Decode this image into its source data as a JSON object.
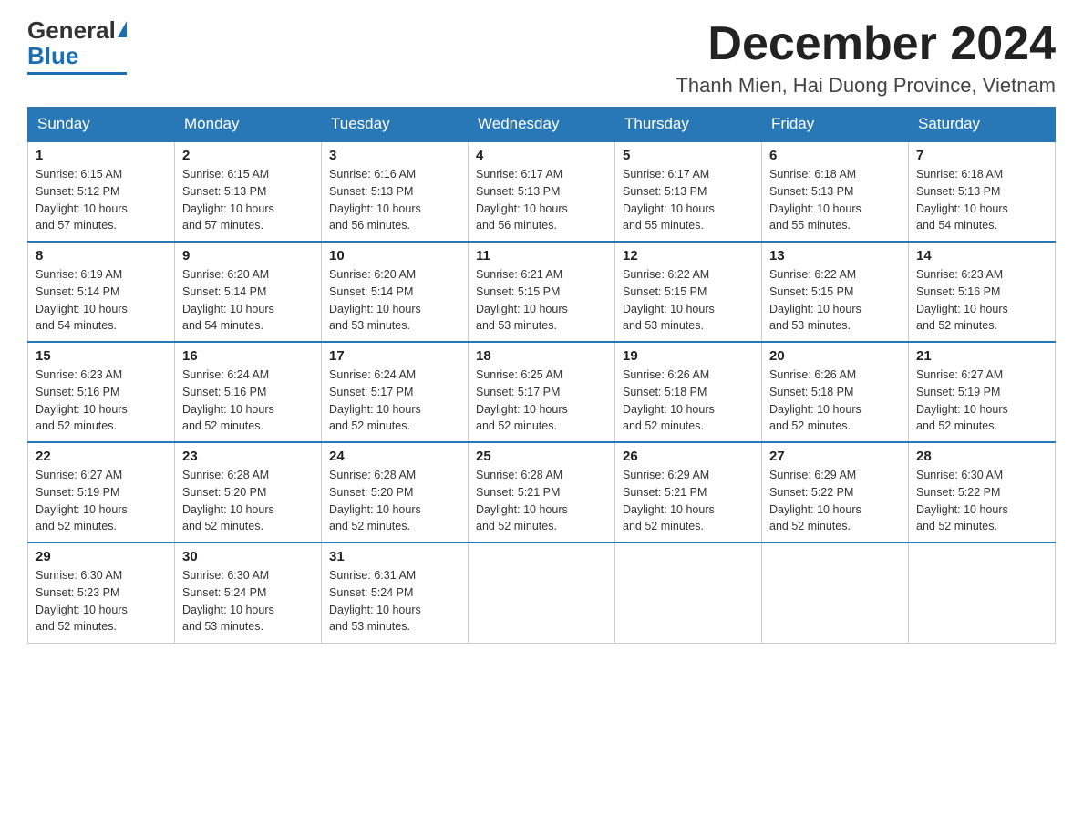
{
  "logo": {
    "general": "General",
    "blue": "Blue"
  },
  "title": "December 2024",
  "location": "Thanh Mien, Hai Duong Province, Vietnam",
  "days_of_week": [
    "Sunday",
    "Monday",
    "Tuesday",
    "Wednesday",
    "Thursday",
    "Friday",
    "Saturday"
  ],
  "weeks": [
    [
      {
        "day": "1",
        "sunrise": "6:15 AM",
        "sunset": "5:12 PM",
        "daylight": "10 hours and 57 minutes."
      },
      {
        "day": "2",
        "sunrise": "6:15 AM",
        "sunset": "5:13 PM",
        "daylight": "10 hours and 57 minutes."
      },
      {
        "day": "3",
        "sunrise": "6:16 AM",
        "sunset": "5:13 PM",
        "daylight": "10 hours and 56 minutes."
      },
      {
        "day": "4",
        "sunrise": "6:17 AM",
        "sunset": "5:13 PM",
        "daylight": "10 hours and 56 minutes."
      },
      {
        "day": "5",
        "sunrise": "6:17 AM",
        "sunset": "5:13 PM",
        "daylight": "10 hours and 55 minutes."
      },
      {
        "day": "6",
        "sunrise": "6:18 AM",
        "sunset": "5:13 PM",
        "daylight": "10 hours and 55 minutes."
      },
      {
        "day": "7",
        "sunrise": "6:18 AM",
        "sunset": "5:13 PM",
        "daylight": "10 hours and 54 minutes."
      }
    ],
    [
      {
        "day": "8",
        "sunrise": "6:19 AM",
        "sunset": "5:14 PM",
        "daylight": "10 hours and 54 minutes."
      },
      {
        "day": "9",
        "sunrise": "6:20 AM",
        "sunset": "5:14 PM",
        "daylight": "10 hours and 54 minutes."
      },
      {
        "day": "10",
        "sunrise": "6:20 AM",
        "sunset": "5:14 PM",
        "daylight": "10 hours and 53 minutes."
      },
      {
        "day": "11",
        "sunrise": "6:21 AM",
        "sunset": "5:15 PM",
        "daylight": "10 hours and 53 minutes."
      },
      {
        "day": "12",
        "sunrise": "6:22 AM",
        "sunset": "5:15 PM",
        "daylight": "10 hours and 53 minutes."
      },
      {
        "day": "13",
        "sunrise": "6:22 AM",
        "sunset": "5:15 PM",
        "daylight": "10 hours and 53 minutes."
      },
      {
        "day": "14",
        "sunrise": "6:23 AM",
        "sunset": "5:16 PM",
        "daylight": "10 hours and 52 minutes."
      }
    ],
    [
      {
        "day": "15",
        "sunrise": "6:23 AM",
        "sunset": "5:16 PM",
        "daylight": "10 hours and 52 minutes."
      },
      {
        "day": "16",
        "sunrise": "6:24 AM",
        "sunset": "5:16 PM",
        "daylight": "10 hours and 52 minutes."
      },
      {
        "day": "17",
        "sunrise": "6:24 AM",
        "sunset": "5:17 PM",
        "daylight": "10 hours and 52 minutes."
      },
      {
        "day": "18",
        "sunrise": "6:25 AM",
        "sunset": "5:17 PM",
        "daylight": "10 hours and 52 minutes."
      },
      {
        "day": "19",
        "sunrise": "6:26 AM",
        "sunset": "5:18 PM",
        "daylight": "10 hours and 52 minutes."
      },
      {
        "day": "20",
        "sunrise": "6:26 AM",
        "sunset": "5:18 PM",
        "daylight": "10 hours and 52 minutes."
      },
      {
        "day": "21",
        "sunrise": "6:27 AM",
        "sunset": "5:19 PM",
        "daylight": "10 hours and 52 minutes."
      }
    ],
    [
      {
        "day": "22",
        "sunrise": "6:27 AM",
        "sunset": "5:19 PM",
        "daylight": "10 hours and 52 minutes."
      },
      {
        "day": "23",
        "sunrise": "6:28 AM",
        "sunset": "5:20 PM",
        "daylight": "10 hours and 52 minutes."
      },
      {
        "day": "24",
        "sunrise": "6:28 AM",
        "sunset": "5:20 PM",
        "daylight": "10 hours and 52 minutes."
      },
      {
        "day": "25",
        "sunrise": "6:28 AM",
        "sunset": "5:21 PM",
        "daylight": "10 hours and 52 minutes."
      },
      {
        "day": "26",
        "sunrise": "6:29 AM",
        "sunset": "5:21 PM",
        "daylight": "10 hours and 52 minutes."
      },
      {
        "day": "27",
        "sunrise": "6:29 AM",
        "sunset": "5:22 PM",
        "daylight": "10 hours and 52 minutes."
      },
      {
        "day": "28",
        "sunrise": "6:30 AM",
        "sunset": "5:22 PM",
        "daylight": "10 hours and 52 minutes."
      }
    ],
    [
      {
        "day": "29",
        "sunrise": "6:30 AM",
        "sunset": "5:23 PM",
        "daylight": "10 hours and 52 minutes."
      },
      {
        "day": "30",
        "sunrise": "6:30 AM",
        "sunset": "5:24 PM",
        "daylight": "10 hours and 53 minutes."
      },
      {
        "day": "31",
        "sunrise": "6:31 AM",
        "sunset": "5:24 PM",
        "daylight": "10 hours and 53 minutes."
      },
      null,
      null,
      null,
      null
    ]
  ],
  "labels": {
    "sunrise": "Sunrise:",
    "sunset": "Sunset:",
    "daylight": "Daylight:"
  }
}
